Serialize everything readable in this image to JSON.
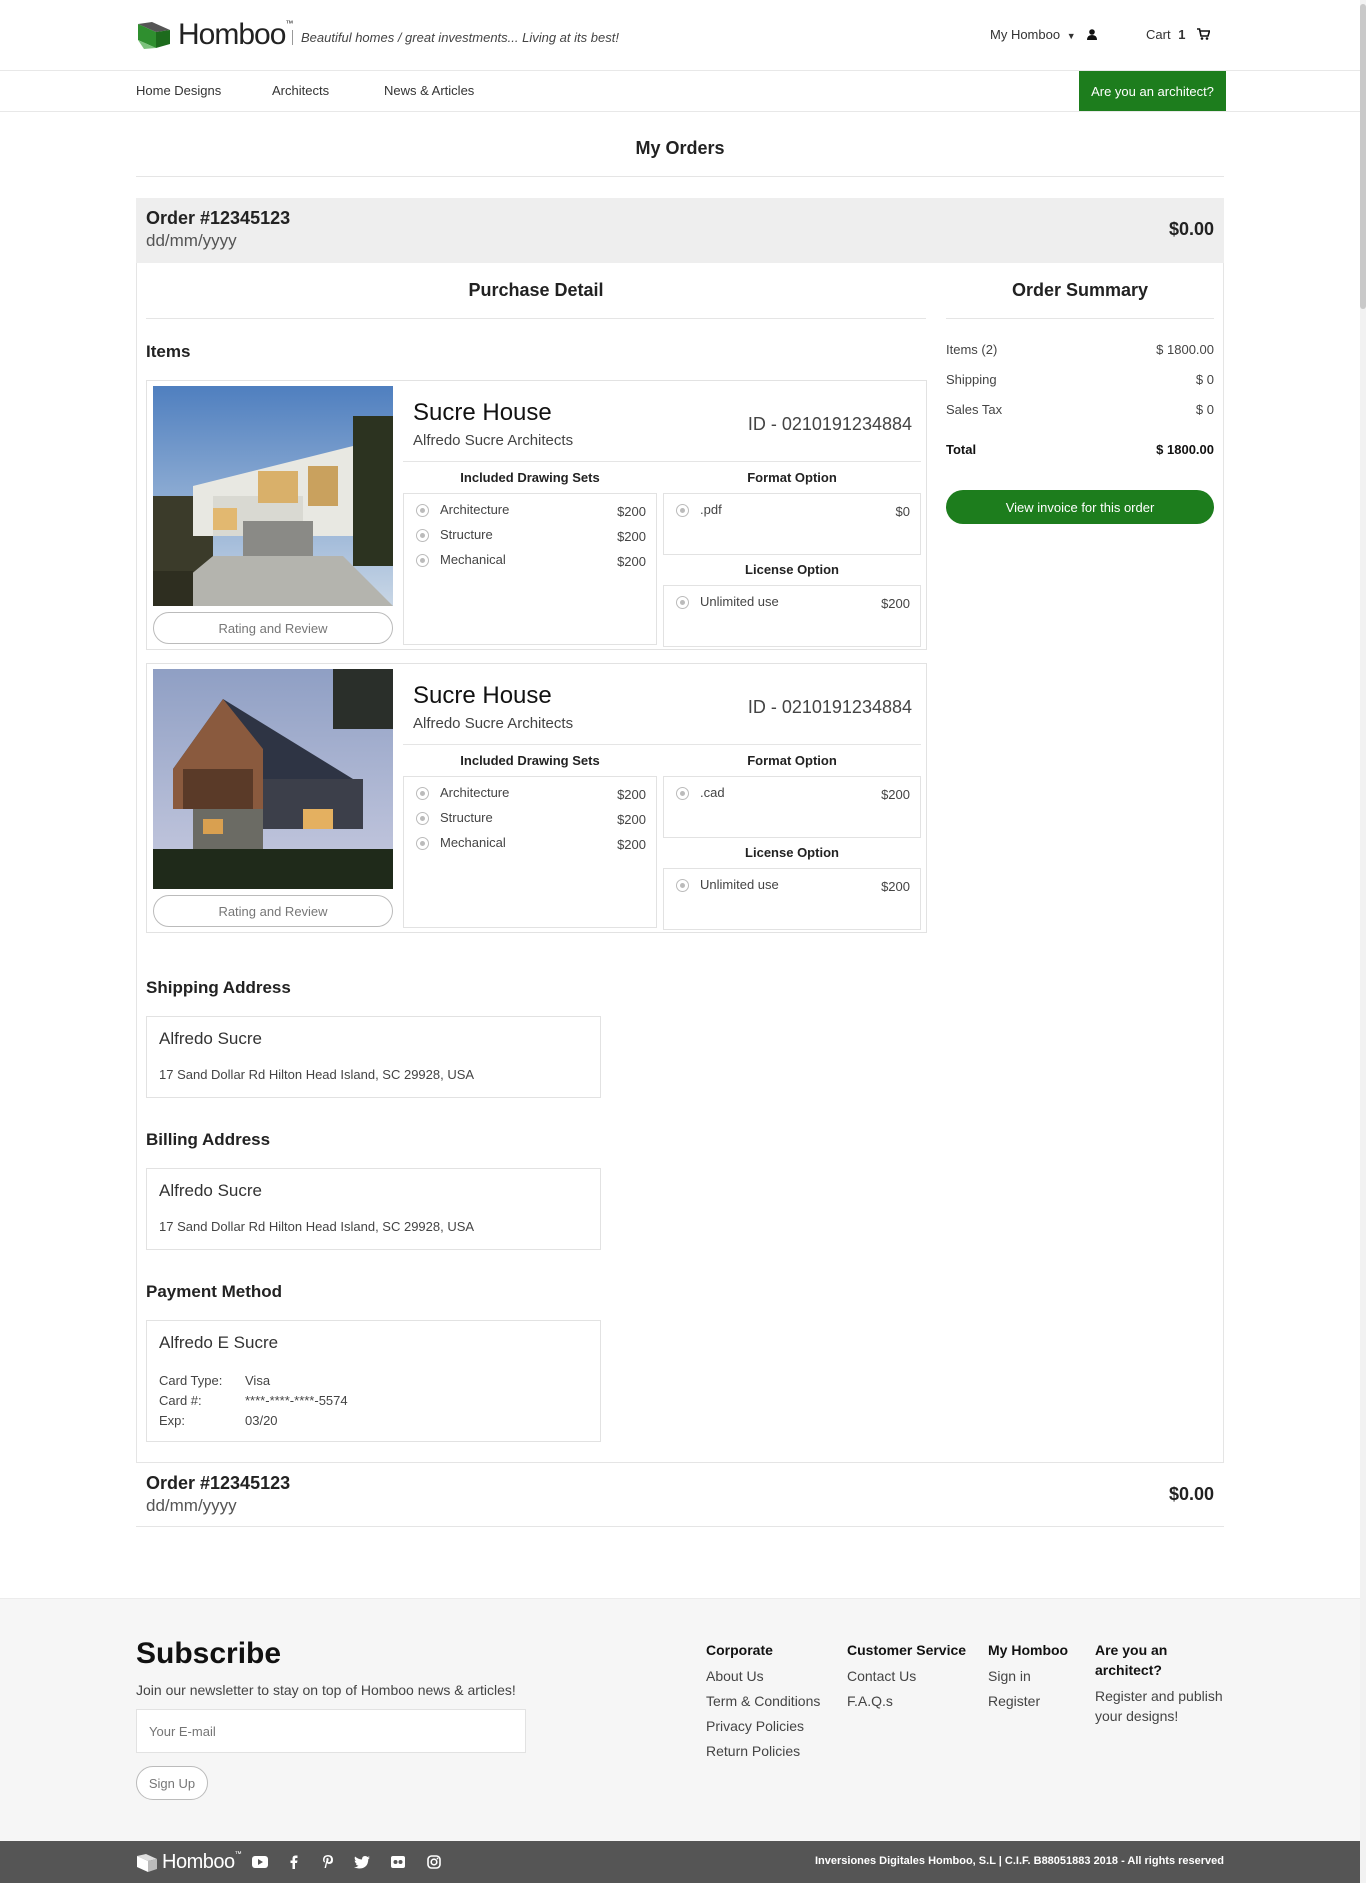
{
  "header": {
    "logo_text": "Homboo",
    "logo_tm": "™",
    "tagline": "Beautiful homes / great investments... Living at its best!",
    "my_homboo": "My Homboo",
    "cart_label": "Cart",
    "cart_count": "1"
  },
  "nav": {
    "items": [
      "Home Designs",
      "Architects",
      "News & Articles"
    ],
    "architect_button": "Are you an architect?"
  },
  "page_title": "My Orders",
  "orders": [
    {
      "number": "Order #12345123",
      "date": "dd/mm/yyyy",
      "total": "$0.00"
    },
    {
      "number": "Order #12345123",
      "date": "dd/mm/yyyy",
      "total": "$0.00"
    }
  ],
  "purchase_detail": {
    "heading": "Purchase Detail",
    "items_label": "Items",
    "drawing_sets_label": "Included Drawing Sets",
    "format_label": "Format Option",
    "license_label": "License Option",
    "rating_button": "Rating and Review",
    "items": [
      {
        "name": "Sucre House",
        "architect": "Alfredo Sucre Architects",
        "id": "ID - 0210191234884",
        "sets": [
          {
            "label": "Architecture",
            "price": "$200"
          },
          {
            "label": "Structure",
            "price": "$200"
          },
          {
            "label": "Mechanical",
            "price": "$200"
          }
        ],
        "format": {
          "label": ".pdf",
          "price": "$0"
        },
        "license": {
          "label": "Unlimited use",
          "price": "$200"
        }
      },
      {
        "name": "Sucre House",
        "architect": "Alfredo Sucre Architects",
        "id": "ID - 0210191234884",
        "sets": [
          {
            "label": "Architecture",
            "price": "$200"
          },
          {
            "label": "Structure",
            "price": "$200"
          },
          {
            "label": "Mechanical",
            "price": "$200"
          }
        ],
        "format": {
          "label": ".cad",
          "price": "$200"
        },
        "license": {
          "label": "Unlimited use",
          "price": "$200"
        }
      }
    ]
  },
  "order_summary": {
    "heading": "Order Summary",
    "rows": [
      {
        "label": "Items (2)",
        "value": "$ 1800.00"
      },
      {
        "label": "Shipping",
        "value": "$ 0"
      },
      {
        "label": "Sales Tax",
        "value": "$ 0"
      }
    ],
    "total_label": "Total",
    "total_value": "$ 1800.00",
    "invoice_button": "View invoice for this order"
  },
  "shipping": {
    "label": "Shipping Address",
    "name": "Alfredo Sucre",
    "address": "17 Sand Dollar Rd Hilton Head Island, SC 29928, USA"
  },
  "billing": {
    "label": "Billing Address",
    "name": "Alfredo Sucre",
    "address": "17 Sand Dollar Rd Hilton Head Island, SC 29928, USA"
  },
  "payment": {
    "label": "Payment Method",
    "name": "Alfredo E Sucre",
    "card_type_label": "Card Type:",
    "card_type": "Visa",
    "card_num_label": "Card #:",
    "card_num": "****-****-****-5574",
    "exp_label": "Exp:",
    "exp": "03/20"
  },
  "footer": {
    "subscribe_title": "Subscribe",
    "subscribe_text": "Join our newsletter to stay on top of Homboo news & articles!",
    "email_placeholder": "Your E-mail",
    "signup_button": "Sign Up",
    "columns": [
      {
        "title": "Corporate",
        "links": [
          "About Us",
          "Term & Conditions",
          "Privacy Policies",
          "Return Policies"
        ]
      },
      {
        "title": "Customer Service",
        "links": [
          "Contact Us",
          "F.A.Q.s"
        ]
      },
      {
        "title": "My Homboo",
        "links": [
          "Sign in",
          "Register"
        ]
      }
    ],
    "architect_title": "Are you an architect?",
    "architect_text": "Register and publish your designs!",
    "legal": "Inversiones Digitales Homboo, S.L | C.I.F. B88051883 2018 - All rights reserved",
    "social_icons": [
      "youtube-icon",
      "facebook-icon",
      "pinterest-icon",
      "twitter-icon",
      "flickr-icon",
      "instagram-icon"
    ]
  },
  "colors": {
    "accent": "#1d7d1d",
    "order_bg": "#eeeeee",
    "footer_bg": "#f6f6f6",
    "bottom_bar": "#555555"
  }
}
